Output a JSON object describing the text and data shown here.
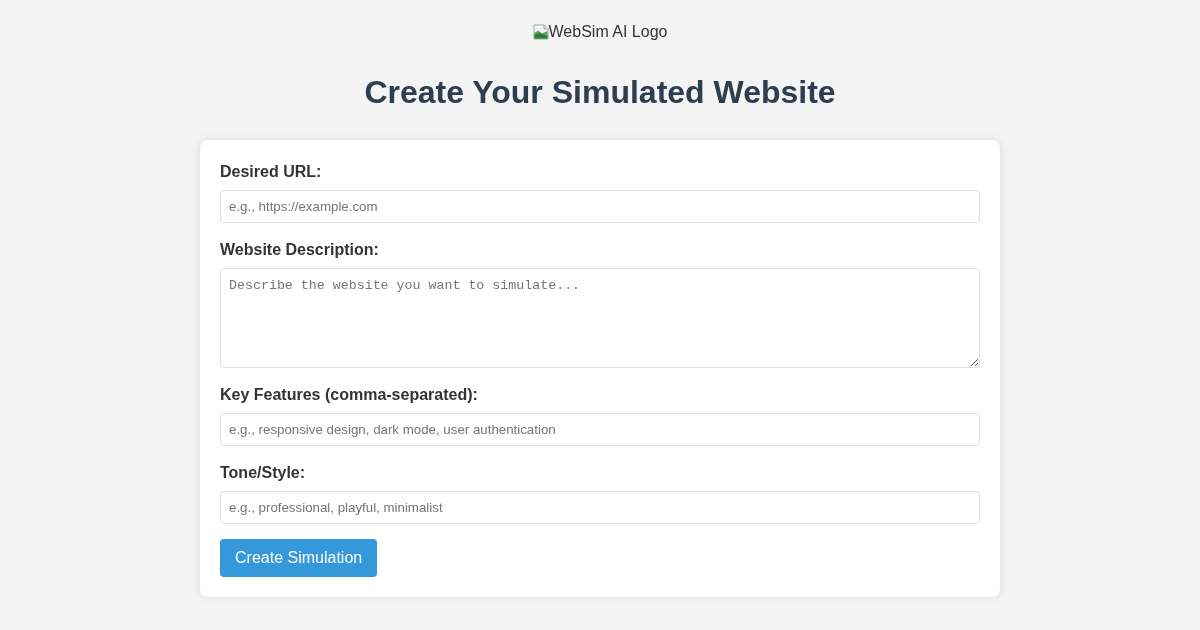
{
  "logo": {
    "alt_text": "WebSim AI Logo"
  },
  "heading": "Create Your Simulated Website",
  "form": {
    "fields": [
      {
        "kind": "input",
        "label": "Desired URL:",
        "placeholder": "e.g., https://example.com"
      },
      {
        "kind": "textarea",
        "label": "Website Description:",
        "placeholder": "Describe the website you want to simulate..."
      },
      {
        "kind": "input",
        "label": "Key Features (comma-separated):",
        "placeholder": "e.g., responsive design, dark mode, user authentication"
      },
      {
        "kind": "input",
        "label": "Tone/Style:",
        "placeholder": "e.g., professional, playful, minimalist"
      }
    ],
    "submit_button": "Create Simulation"
  }
}
